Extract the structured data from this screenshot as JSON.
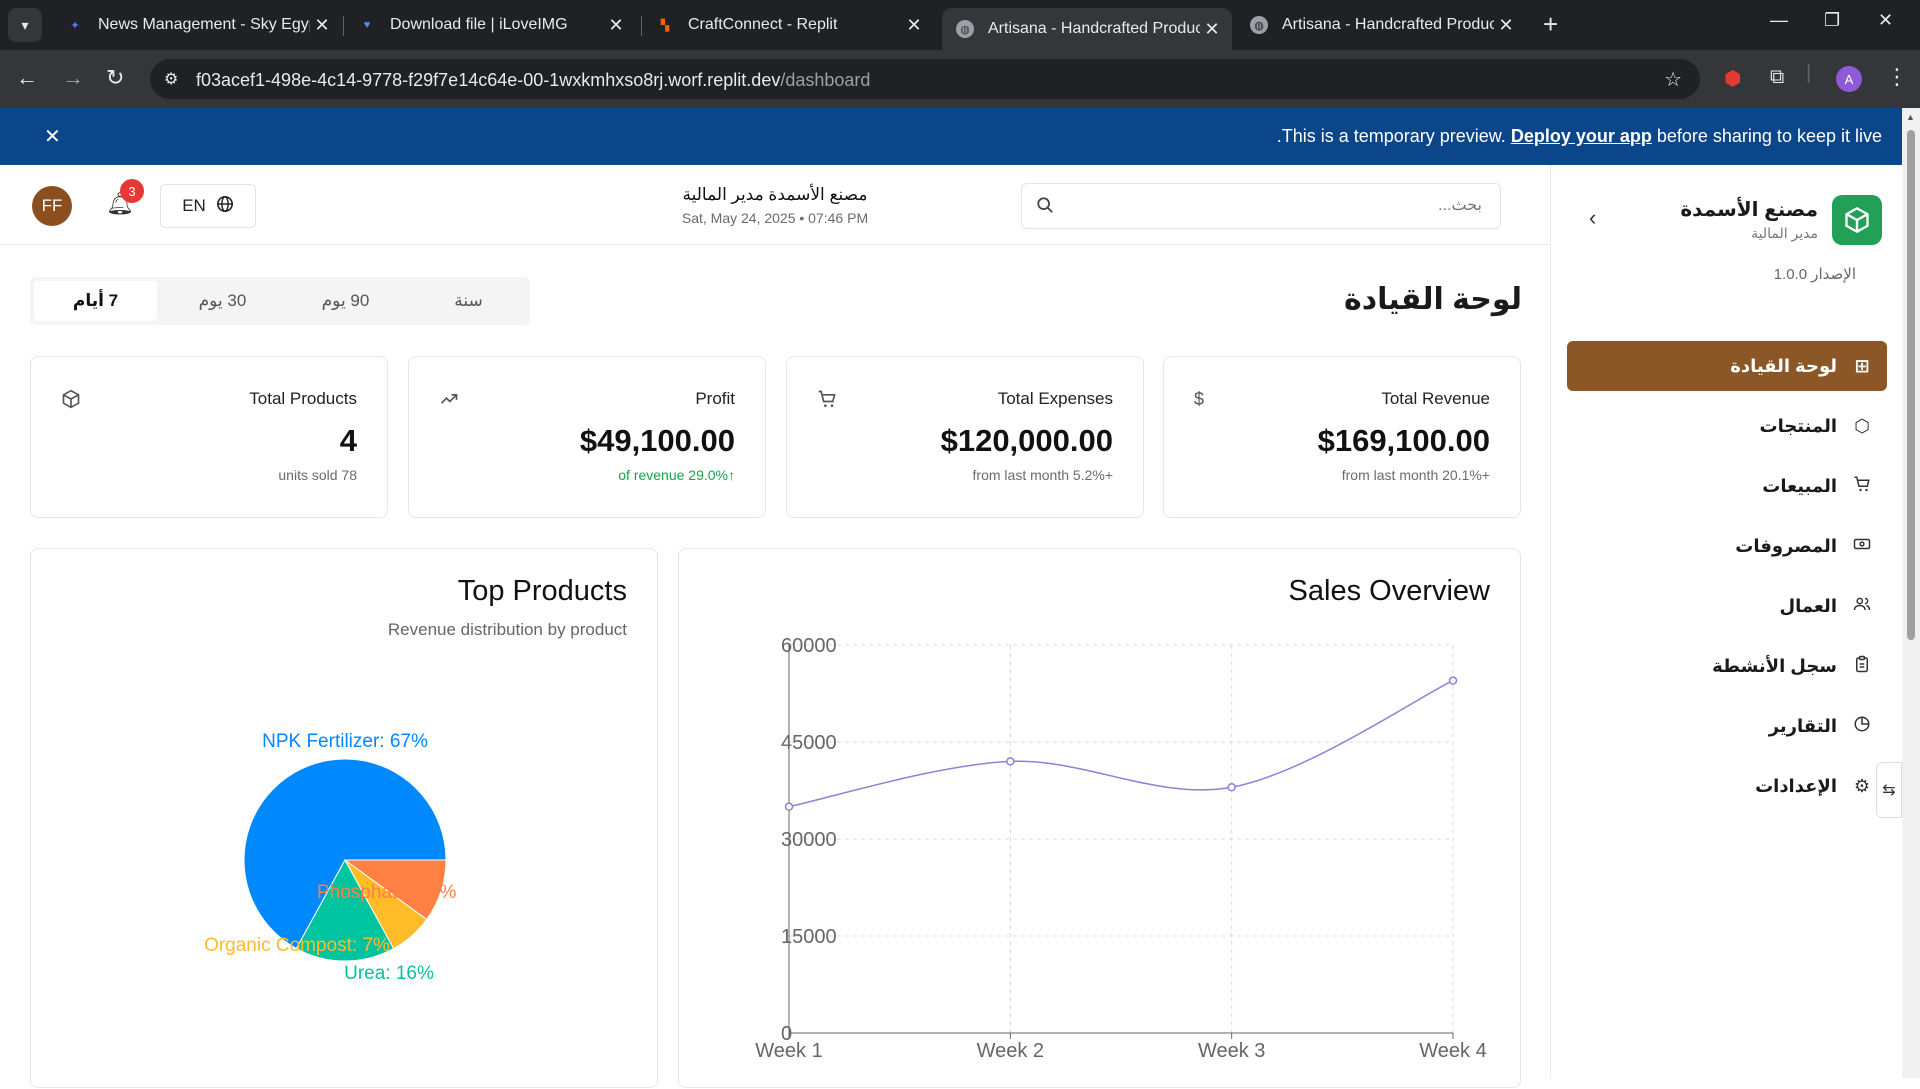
{
  "browser": {
    "tabs": [
      {
        "title": "News Management - Sky Egypt",
        "active": false
      },
      {
        "title": "Download file | iLoveIMG",
        "active": false
      },
      {
        "title": "CraftConnect - Replit",
        "active": false
      },
      {
        "title": "Artisana - Handcrafted Products",
        "active": true
      },
      {
        "title": "Artisana - Handcrafted Products",
        "active": false
      }
    ],
    "url_host": "f03acef1-498e-4c14-9778-f29f7e14c64e-00-1wxkmhxso8rj.worf.replit.dev",
    "url_path": "/dashboard",
    "profile_initial": "A"
  },
  "banner": {
    "message_start": ".This is a temporary preview. ",
    "link": "Deploy your app",
    "message_end": " before sharing to keep it live"
  },
  "header": {
    "avatar_initials": "FF",
    "notification_count": "3",
    "language": "EN",
    "company": "مصنع الأسمدة مدير المالية",
    "datetime": "Sat, May 24, 2025 • 07:46 PM",
    "search_placeholder": "بحث..."
  },
  "sidebar": {
    "brand_name": "مصنع الأسمدة",
    "brand_role": "مدير المالية",
    "version": "الإصدار 1.0.0",
    "items": [
      {
        "label": "لوحة القيادة",
        "icon": "grid-icon",
        "active": true
      },
      {
        "label": "المنتجات",
        "icon": "box-icon",
        "active": false
      },
      {
        "label": "المبيعات",
        "icon": "cart-icon",
        "active": false
      },
      {
        "label": "المصروفات",
        "icon": "banknote-icon",
        "active": false
      },
      {
        "label": "العمال",
        "icon": "users-icon",
        "active": false
      },
      {
        "label": "سجل الأنشطة",
        "icon": "clipboard-icon",
        "active": false
      },
      {
        "label": "التقارير",
        "icon": "pie-icon",
        "active": false
      },
      {
        "label": "الإعدادات",
        "icon": "gear-icon",
        "active": false
      }
    ]
  },
  "main": {
    "title": "لوحة القيادة",
    "periods": [
      "سنة",
      "90 يوم",
      "30 يوم",
      "7 أيام"
    ],
    "active_period": "7 أيام",
    "stats": [
      {
        "title": "Total Revenue",
        "value": "$169,100.00",
        "sub": "from last month 20.1%+",
        "icon": "dollar-icon",
        "positive": false
      },
      {
        "title": "Total Expenses",
        "value": "$120,000.00",
        "sub": "from last month 5.2%+",
        "icon": "cart-icon",
        "positive": false
      },
      {
        "title": "Profit",
        "value": "$49,100.00",
        "sub": "of revenue 29.0%",
        "icon": "trending-up-icon",
        "positive": true
      },
      {
        "title": "Total Products",
        "value": "4",
        "sub": "units sold 78",
        "icon": "box-icon",
        "positive": false
      }
    ]
  },
  "sales_card": {
    "title": "Sales Overview"
  },
  "products_card": {
    "title": "Top Products",
    "subtitle": "Revenue distribution by product"
  },
  "chart_data": [
    {
      "type": "line",
      "x": [
        "Week 1",
        "Week 2",
        "Week 3",
        "Week 4"
      ],
      "series": [
        {
          "values": [
            35000,
            42000,
            38000,
            54500
          ],
          "color": "#8884d8"
        }
      ],
      "ylim": [
        0,
        60000
      ],
      "yticks": [
        0,
        15000,
        30000,
        45000,
        60000
      ],
      "grid": true
    },
    {
      "type": "pie",
      "slices": [
        {
          "label": "NPK Fertilizer: 67%",
          "value": 67,
          "color": "#0088fe"
        },
        {
          "label": "Urea: 16%",
          "value": 16,
          "color": "#00c49f"
        },
        {
          "label": "Organic Compost: 7%",
          "value": 7,
          "color": "#ffbb28"
        },
        {
          "label": "Phosphate: 10%",
          "value": 10,
          "color": "#ff8042"
        }
      ]
    }
  ]
}
